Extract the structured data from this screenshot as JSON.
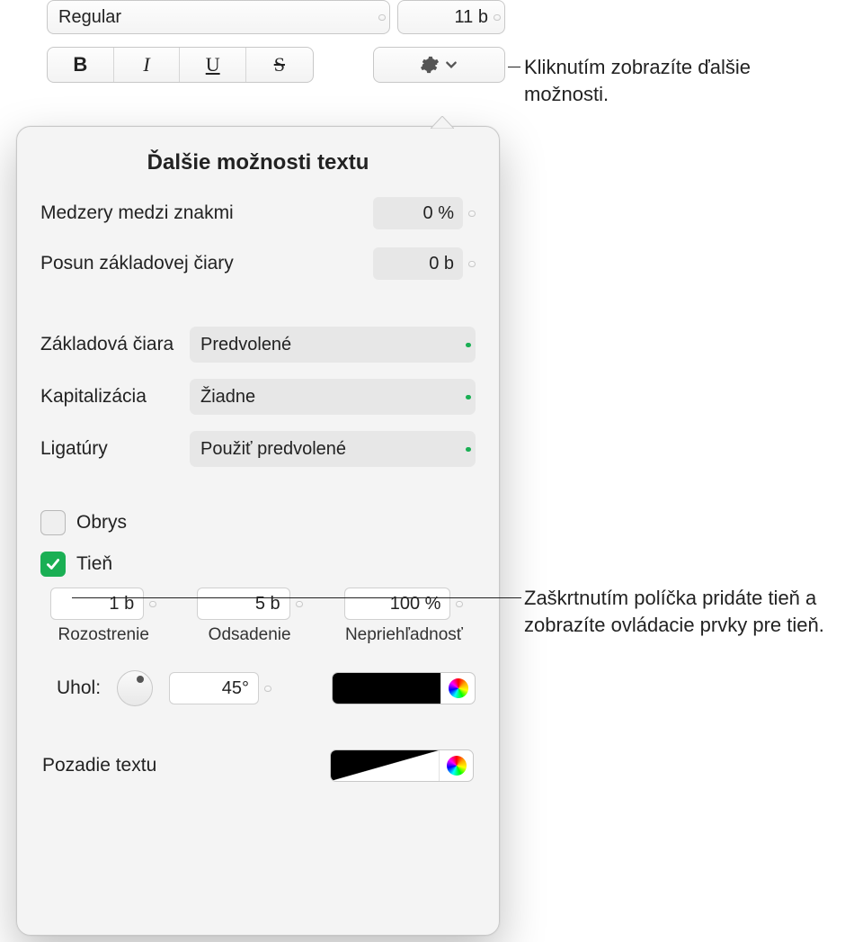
{
  "top": {
    "font_style": "Regular",
    "font_size": "11 b"
  },
  "style_buttons": {
    "bold": "B",
    "italic": "I",
    "underline": "U",
    "strike": "S"
  },
  "popover": {
    "title": "Ďalšie možnosti textu",
    "char_spacing": {
      "label": "Medzery medzi znakmi",
      "value": "0 %"
    },
    "baseline_shift": {
      "label": "Posun základovej čiary",
      "value": "0 b"
    },
    "baseline": {
      "label": "Základová čiara",
      "value": "Predvolené"
    },
    "capitalization": {
      "label": "Kapitalizácia",
      "value": "Žiadne"
    },
    "ligatures": {
      "label": "Ligatúry",
      "value": "Použiť predvolené"
    },
    "outline": {
      "label": "Obrys",
      "checked": false
    },
    "shadow": {
      "label": "Tieň",
      "checked": true,
      "blur": {
        "value": "1 b",
        "label": "Rozostrenie"
      },
      "offset": {
        "value": "5 b",
        "label": "Odsadenie"
      },
      "opacity": {
        "value": "100 %",
        "label": "Nepriehľadnosť"
      },
      "angle": {
        "label": "Uhol:",
        "value": "45°"
      }
    },
    "text_bg": {
      "label": "Pozadie textu"
    }
  },
  "callouts": {
    "gear": "Kliknutím zobrazíte ďalšie možnosti.",
    "shadow": "Zaškrtnutím políčka pridáte tieň a zobrazíte ovládacie prvky pre tieň."
  }
}
